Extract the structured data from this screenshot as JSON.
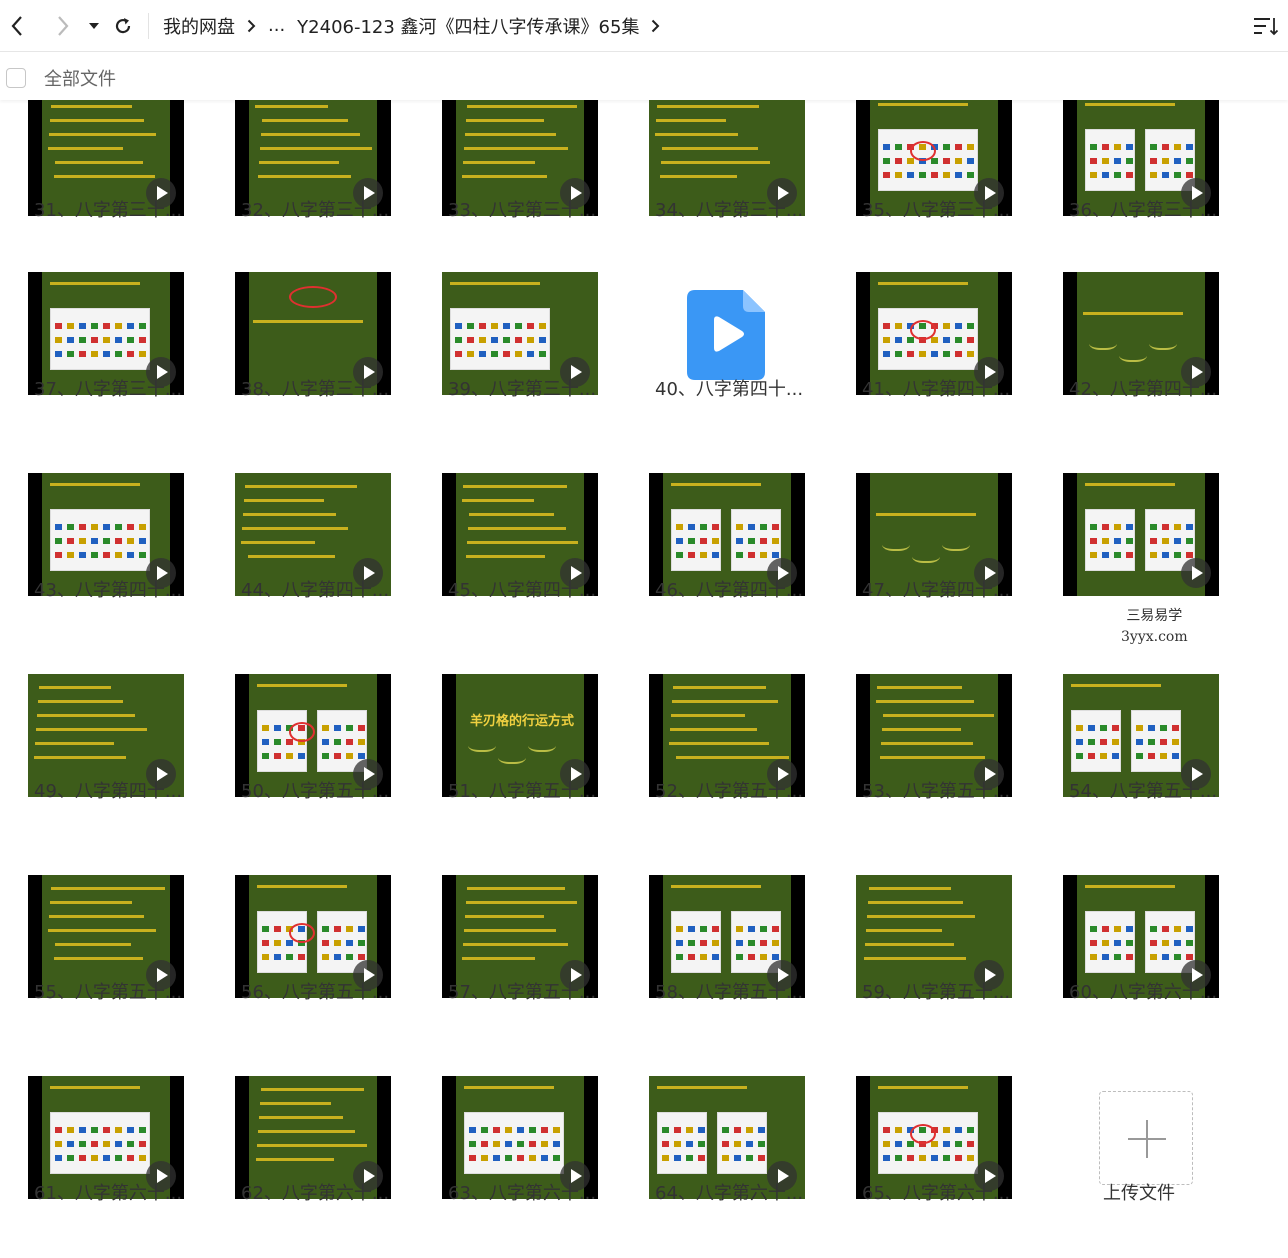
{
  "header": {
    "breadcrumb_root": "我的网盘",
    "breadcrumb_ellipsis": "...",
    "breadcrumb_current": "Y2406-123 鑫河《四柱八字传承课》65集"
  },
  "toolbar": {
    "select_all_label": "全部文件"
  },
  "files": [
    {
      "label": "31、八字第三十...",
      "kind": "text"
    },
    {
      "label": "32、八字第三十...",
      "kind": "text"
    },
    {
      "label": "33、八字第三十...",
      "kind": "text"
    },
    {
      "label": "34、八字第三十...",
      "kind": "text"
    },
    {
      "label": "35、八字第三十...",
      "kind": "table"
    },
    {
      "label": "36、八字第三十...",
      "kind": "table"
    },
    {
      "label": "37、八字第三十...",
      "kind": "table"
    },
    {
      "label": "38、八字第三十...",
      "kind": "scribble"
    },
    {
      "label": "39、八字第三十...",
      "kind": "table"
    },
    {
      "label": "40、八字第四十...",
      "kind": "video"
    },
    {
      "label": "41、八字第四十...",
      "kind": "table"
    },
    {
      "label": "42、八字第四十...",
      "kind": "chalk"
    },
    {
      "label": "43、八字第四十...",
      "kind": "table"
    },
    {
      "label": "44、八字第四十...",
      "kind": "text"
    },
    {
      "label": "45、八字第四十...",
      "kind": "text"
    },
    {
      "label": "46、八字第四十...",
      "kind": "table"
    },
    {
      "label": "47、八字第四十...",
      "kind": "chalk"
    },
    {
      "label": "",
      "kind": "table-wm",
      "watermark_line1": "三易易学",
      "watermark_line2": "3yyx.com"
    },
    {
      "label": "49、八字第四十...",
      "kind": "text"
    },
    {
      "label": "50、八字第五十...",
      "kind": "table"
    },
    {
      "label": "51、八字第五十...",
      "kind": "chalk",
      "title": "羊刃格的行运方式"
    },
    {
      "label": "52、八字第五十...",
      "kind": "text"
    },
    {
      "label": "53、八字第五十...",
      "kind": "text"
    },
    {
      "label": "54、八字第五十...",
      "kind": "table"
    },
    {
      "label": "55、八字第五十...",
      "kind": "text"
    },
    {
      "label": "56、八字第五十...",
      "kind": "table"
    },
    {
      "label": "57、八字第五十...",
      "kind": "text"
    },
    {
      "label": "58、八字第五十...",
      "kind": "table"
    },
    {
      "label": "59、八字第五十...",
      "kind": "text"
    },
    {
      "label": "60、八字第六十...",
      "kind": "table"
    },
    {
      "label": "61、八字第六十...",
      "kind": "table"
    },
    {
      "label": "62、八字第六十...",
      "kind": "text"
    },
    {
      "label": "63、八字第六十...",
      "kind": "table"
    },
    {
      "label": "64、八字第六十...",
      "kind": "table"
    },
    {
      "label": "65、八字第六十...",
      "kind": "table"
    }
  ],
  "upload": {
    "label": "上传文件"
  }
}
